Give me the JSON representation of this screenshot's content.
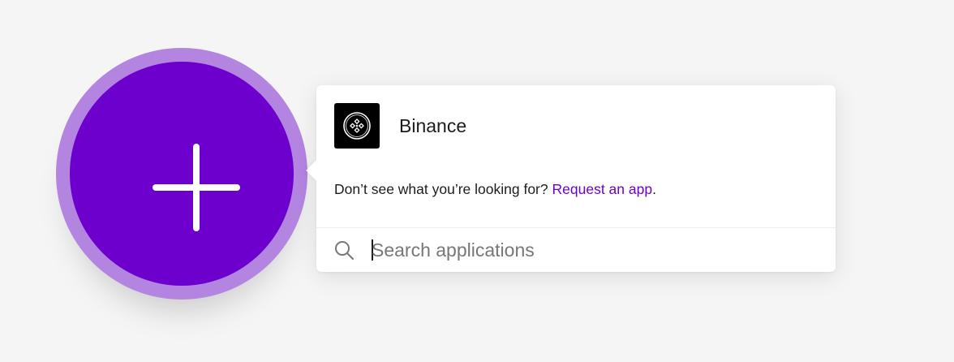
{
  "add_module": {
    "icon": "plus-icon",
    "colors": {
      "outer": "#b384e0",
      "inner": "#6d00cc"
    }
  },
  "popover": {
    "apps": [
      {
        "name": "Binance",
        "icon": "binance-logo-icon"
      }
    ],
    "request": {
      "prompt": "Don’t see what you’re looking for?",
      "link_label": "Request an app",
      "suffix": "."
    },
    "search": {
      "icon": "search-icon",
      "value": "",
      "placeholder": "Search applications"
    }
  },
  "colors": {
    "accent": "#6d00cc",
    "background": "#f5f5f5"
  }
}
